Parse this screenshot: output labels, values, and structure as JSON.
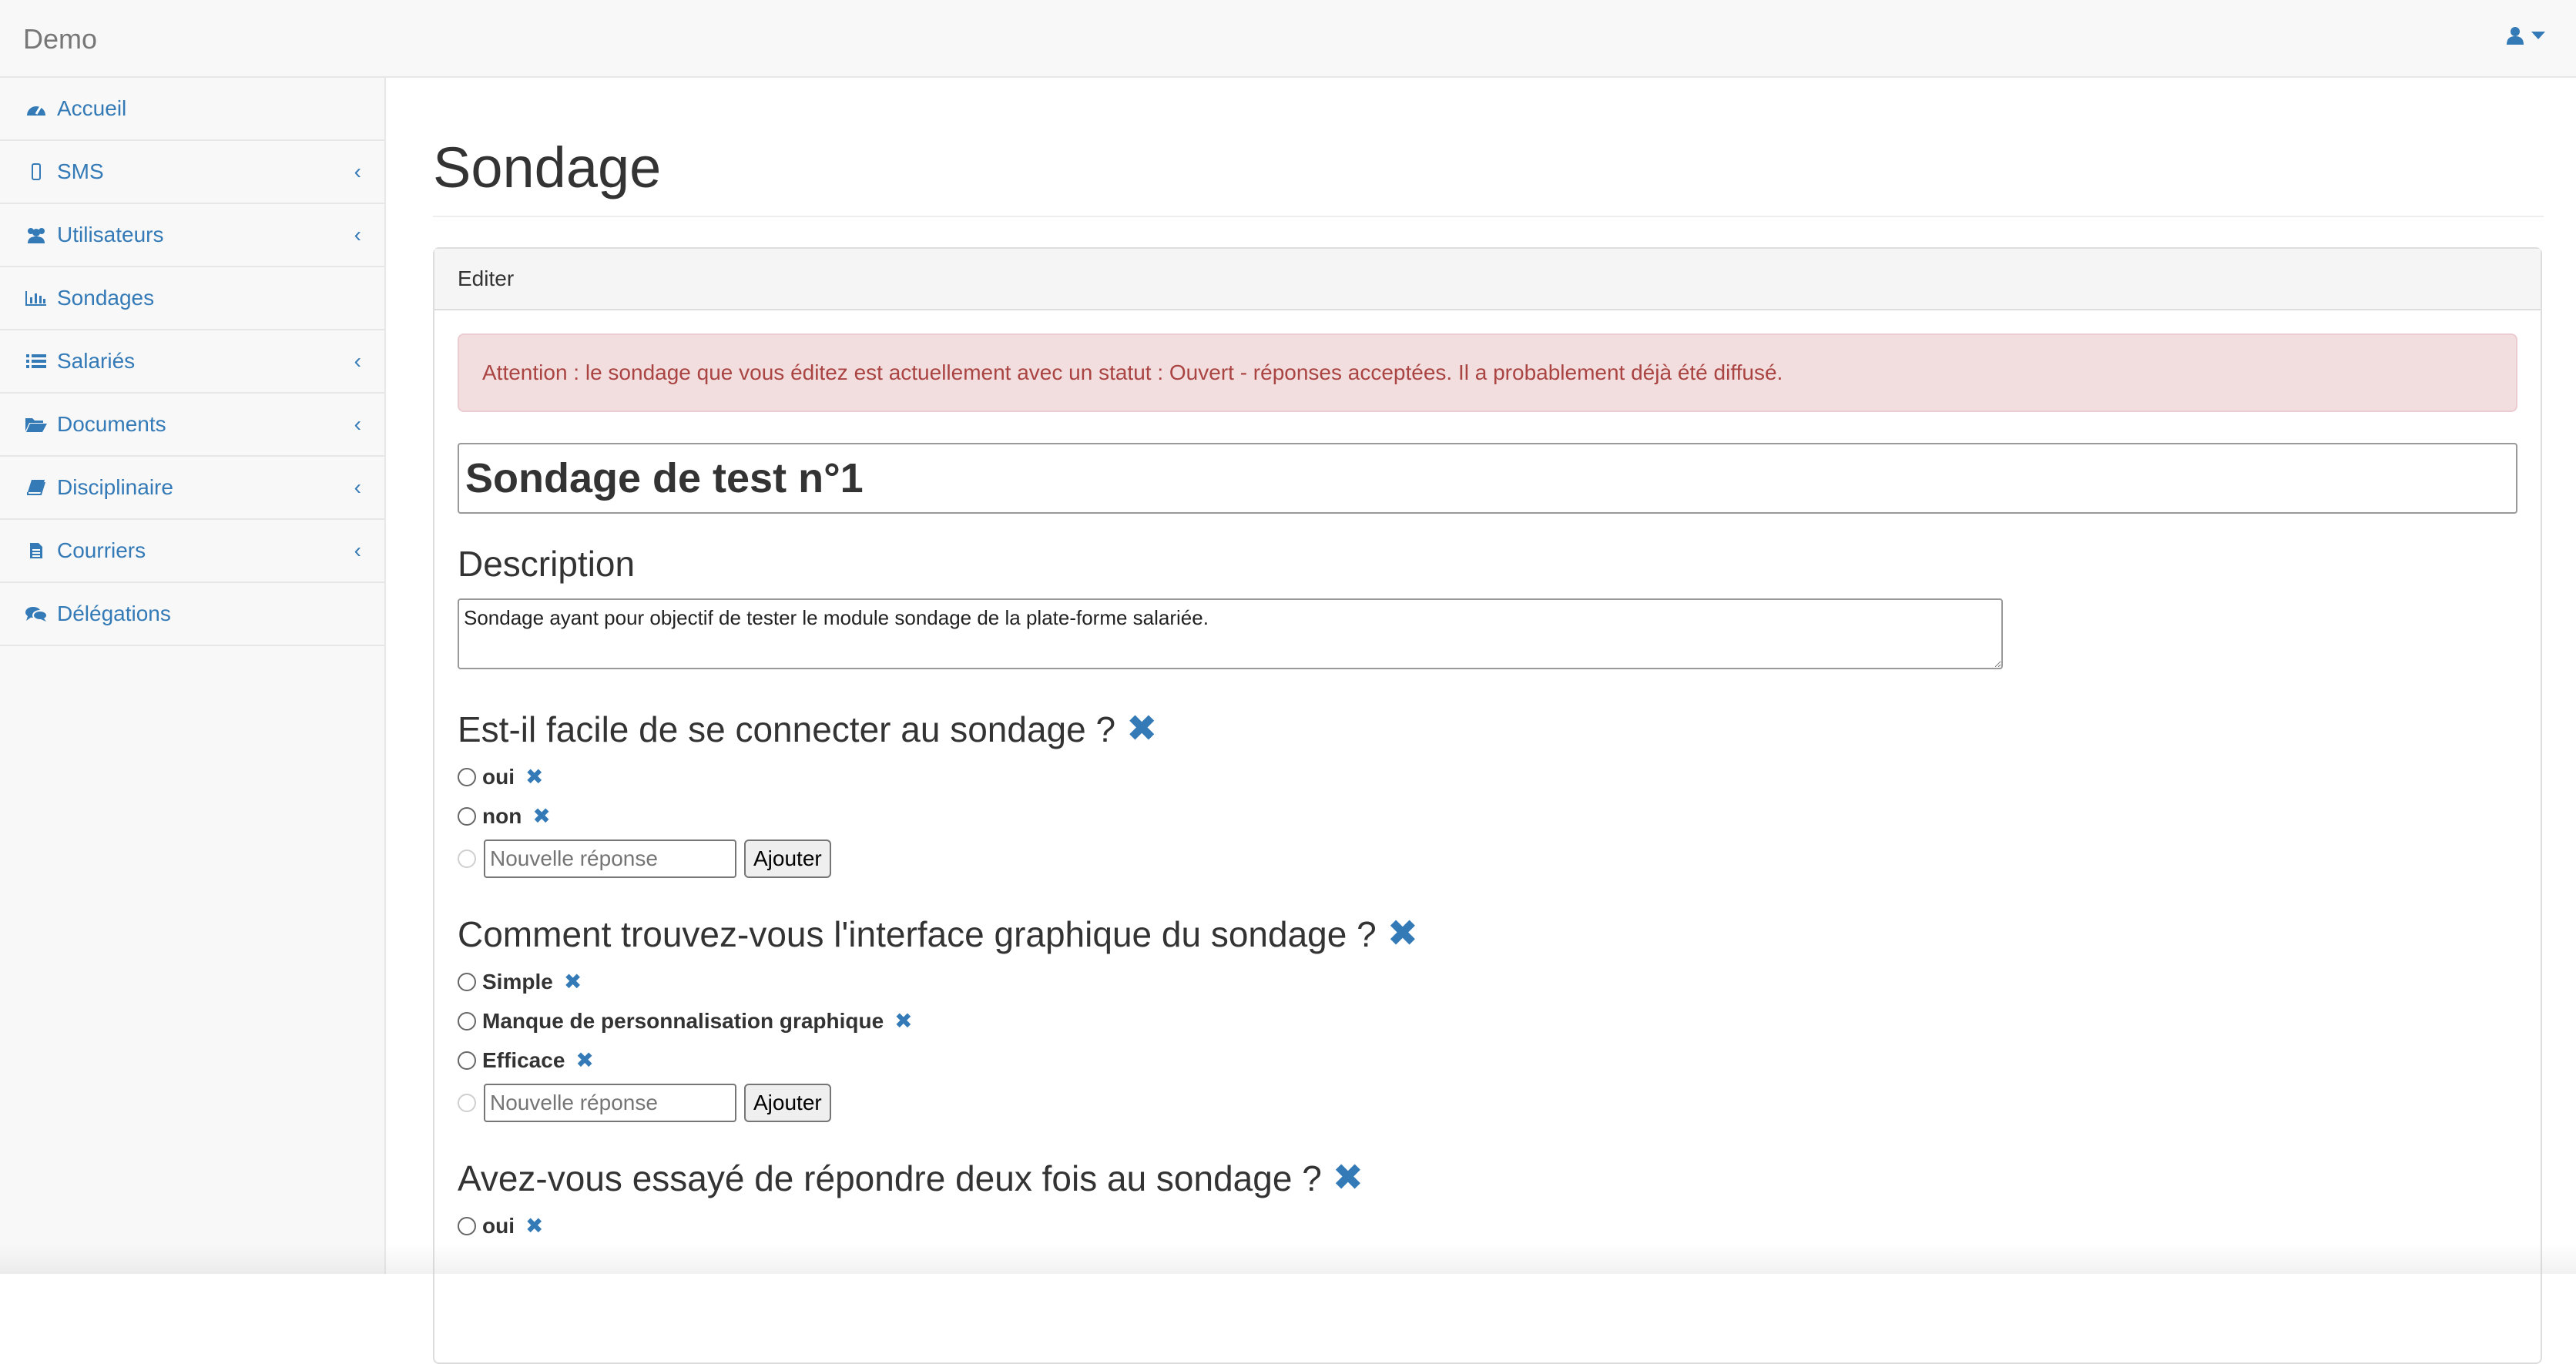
{
  "navbar": {
    "brand": "Demo",
    "user_icon": "user-icon"
  },
  "sidebar": {
    "items": [
      {
        "label": "Accueil",
        "icon": "dashboard-icon",
        "has_submenu": false
      },
      {
        "label": "SMS",
        "icon": "mobile-icon",
        "has_submenu": true
      },
      {
        "label": "Utilisateurs",
        "icon": "users-icon",
        "has_submenu": true
      },
      {
        "label": "Sondages",
        "icon": "bar-chart-icon",
        "has_submenu": false
      },
      {
        "label": "Salariés",
        "icon": "list-icon",
        "has_submenu": true
      },
      {
        "label": "Documents",
        "icon": "folder-open-icon",
        "has_submenu": true
      },
      {
        "label": "Disciplinaire",
        "icon": "book-icon",
        "has_submenu": true
      },
      {
        "label": "Courriers",
        "icon": "file-text-icon",
        "has_submenu": true
      },
      {
        "label": "Délégations",
        "icon": "comments-icon",
        "has_submenu": false
      }
    ]
  },
  "main": {
    "page_title": "Sondage",
    "panel_heading": "Editer",
    "alert": "Attention : le sondage que vous éditez est actuellement avec un statut : Ouvert - réponses acceptées. Il a probablement déjà été diffusé.",
    "survey_title": "Sondage de test n°1",
    "description_heading": "Description",
    "description": "Sondage ayant pour objectif de tester le module sondage de la plate-forme salariée.",
    "new_answer_placeholder": "Nouvelle réponse",
    "add_button": "Ajouter",
    "questions": [
      {
        "title": "Est-il facile de se connecter au sondage ?",
        "answers": [
          "oui",
          "non"
        ]
      },
      {
        "title": "Comment trouvez-vous l'interface graphique du sondage ?",
        "answers": [
          "Simple",
          "Manque de personnalisation graphique",
          "Efficace"
        ]
      },
      {
        "title": "Avez-vous essayé de répondre deux fois au sondage ?",
        "answers": [
          "oui"
        ]
      }
    ]
  },
  "colors": {
    "link": "#337ab7",
    "alert_bg": "#f2dede",
    "alert_text": "#a94442"
  }
}
